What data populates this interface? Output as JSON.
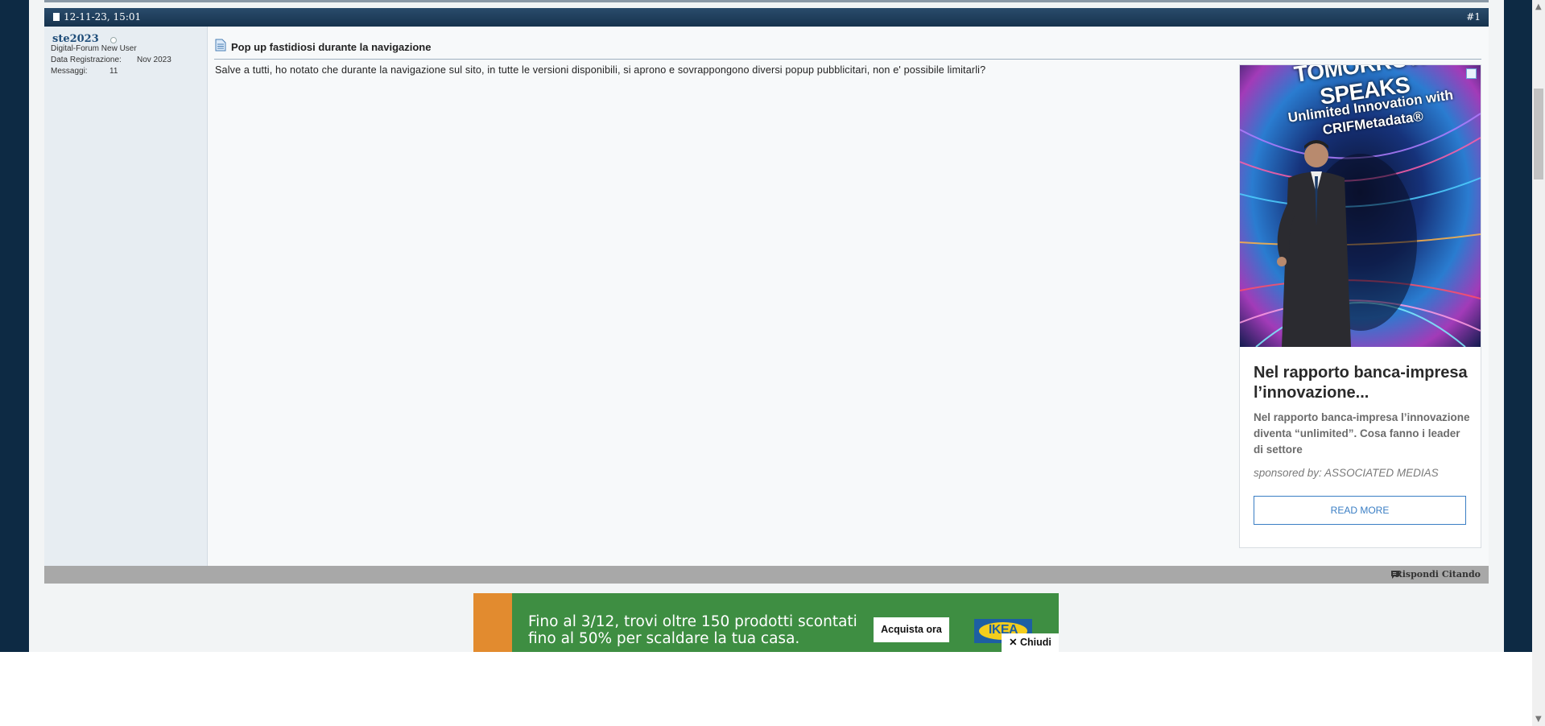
{
  "post": {
    "date": "12-11-23, 15:01",
    "number": "#1",
    "title": "Pop up fastidiosi durante la navigazione",
    "body": "Salve a tutti, ho notato che durante la navigazione sul sito, in tutte le versioni disponibili, si aprono e sovrappongono diversi popup pubblicitari, non e' possibile limitarli?"
  },
  "user": {
    "name": "ste2023",
    "rank": "Digital-Forum New User",
    "reg_label": "Data Registrazione:",
    "reg_value": "Nov 2023",
    "msgs_label": "Messaggi:",
    "msgs_value": "11"
  },
  "ad": {
    "image_headline": "TOMORROW SPEAKS",
    "image_sub": "Unlimited Innovation with CRIFMetadata®",
    "title": "Nel rapporto banca-impresa l’innovazione...",
    "description": "Nel rapporto banca-impresa l’innovazione diventa “unlimited”. Cosa fanno i leader di settore",
    "sponsor": "sponsored by: ASSOCIATED MEDIAS",
    "button": "READ MORE"
  },
  "footer": {
    "reply": "Rispondi Citando"
  },
  "ikea_banner": {
    "text": "Fino al 3/12, trovi oltre 150 prodotti scontati fino al 50% per scaldare la tua casa.",
    "cta": "Acquista ora",
    "logo": "IKEA",
    "close": "✕ Chiudi"
  },
  "icons": [
    "post-icon",
    "document-icon",
    "online-status-icon",
    "reply-quote-icon",
    "adchoices-icon",
    "scroll-up-icon",
    "scroll-down-icon"
  ],
  "colors": {
    "header": "#1c3b58",
    "background": "#0d2a44",
    "ikea_green": "#3e8e42",
    "ikea_orange": "#e28b2f",
    "ad_button": "#3a7ec4"
  }
}
